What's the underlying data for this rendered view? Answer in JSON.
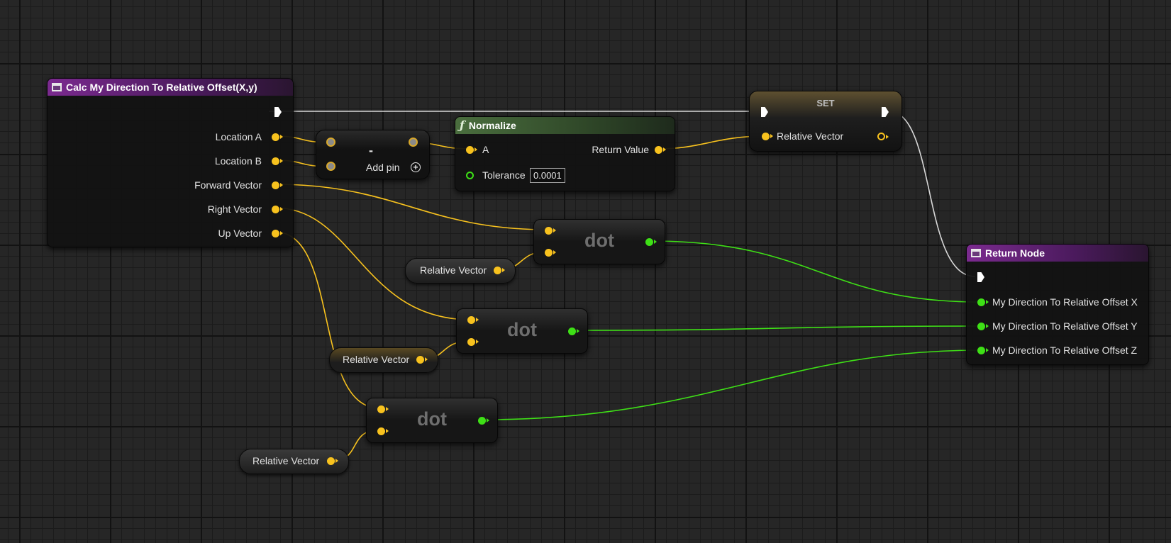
{
  "nodes": {
    "entry": {
      "title": "Calc My Direction To Relative Offset(X,y)",
      "outputs": [
        "Location A",
        "Location B",
        "Forward Vector",
        "Right Vector",
        "Up Vector"
      ]
    },
    "subtract": {
      "symbol": "-",
      "add_pin_label": "Add pin",
      "add_icon": "plus-icon"
    },
    "normalize": {
      "title": "Normalize",
      "icon": "function-icon",
      "input_a": "A",
      "tolerance_label": "Tolerance",
      "tolerance_value": "0.0001",
      "return_label": "Return Value"
    },
    "set": {
      "title": "SET",
      "variable_label": "Relative Vector"
    },
    "dots": [
      {
        "title": "dot"
      },
      {
        "title": "dot"
      },
      {
        "title": "dot"
      }
    ],
    "getters": [
      {
        "label": "Relative Vector"
      },
      {
        "label": "Relative Vector"
      },
      {
        "label": "Relative Vector"
      }
    ],
    "return_node": {
      "title": "Return Node",
      "inputs": [
        "My Direction To Relative Offset X",
        "My Direction To Relative Offset Y",
        "My Direction To Relative Offset Z"
      ]
    }
  },
  "colors": {
    "vector_pin": "#f8c21e",
    "float_pin": "#3ee016",
    "exec_wire": "#ffffff",
    "function_header": "#7b2a8f",
    "pure_function_header": "#4a6e3e",
    "graph_background": "#262626"
  }
}
